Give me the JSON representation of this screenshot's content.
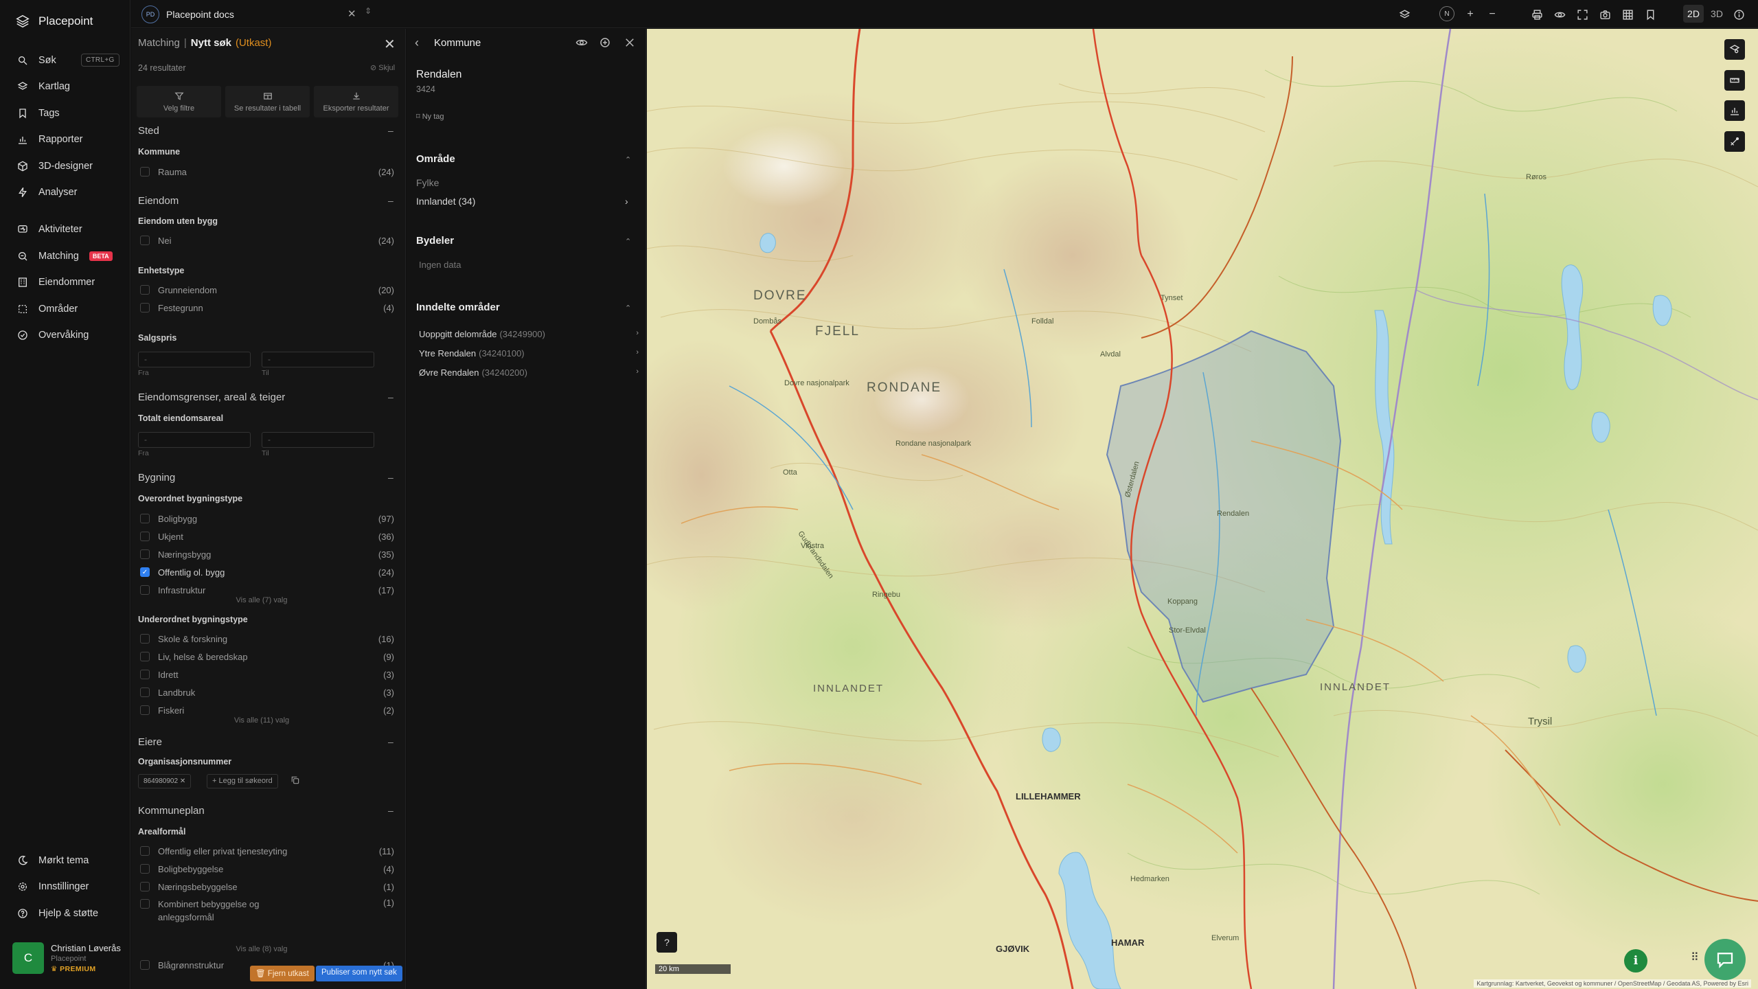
{
  "app": {
    "name": "Placepoint"
  },
  "nav": {
    "shortcut": "CTRL+G",
    "beta": "BETA",
    "items": [
      {
        "label": "Søk",
        "icon": "search-icon"
      },
      {
        "label": "Kartlag",
        "icon": "layers-icon"
      },
      {
        "label": "Tags",
        "icon": "bookmark-icon"
      },
      {
        "label": "Rapporter",
        "icon": "chart-icon"
      },
      {
        "label": "3D-designer",
        "icon": "cube-icon"
      },
      {
        "label": "Analyser",
        "icon": "bolt-icon"
      },
      {
        "label": "Aktiviteter",
        "icon": "activity-icon"
      },
      {
        "label": "Matching",
        "icon": "matching-icon"
      },
      {
        "label": "Eiendommer",
        "icon": "building-icon"
      },
      {
        "label": "Områder",
        "icon": "area-icon"
      },
      {
        "label": "Overvåking",
        "icon": "monitor-icon"
      },
      {
        "label": "Mørkt tema",
        "icon": "moon-icon"
      },
      {
        "label": "Innstillinger",
        "icon": "gear-icon"
      },
      {
        "label": "Hjelp & støtte",
        "icon": "help-icon"
      }
    ],
    "user": {
      "initial": "C",
      "name": "Christian Løverås",
      "org": "Placepoint",
      "plan": "PREMIUM"
    }
  },
  "topbar": {
    "doc_badge": "PD",
    "doc_name": "Placepoint docs",
    "compass": "N",
    "mode_2d": "2D",
    "mode_3d": "3D"
  },
  "search": {
    "crumb": "Matching",
    "title": "Nytt søk",
    "status": "(Utkast)",
    "result_count": "24 resultater",
    "hide": "Skjul",
    "tools": [
      "Velg filtre",
      "Se resultater i tabell",
      "Eksporter resultater"
    ],
    "sections": {
      "sted": "Sted",
      "kommune": "Kommune",
      "kommune_items": [
        {
          "label": "Rauma",
          "count": "(24)"
        }
      ],
      "eiendom": "Eiendom",
      "uten_bygg": "Eiendom uten bygg",
      "uten_bygg_items": [
        {
          "label": "Nei",
          "count": "(24)"
        }
      ],
      "enhetstype": "Enhetstype",
      "enhetstype_items": [
        {
          "label": "Grunneiendom",
          "count": "(20)"
        },
        {
          "label": "Festegrunn",
          "count": "(4)"
        }
      ],
      "salgspris": "Salgspris",
      "grenser": "Eiendomsgrenser, areal & teiger",
      "totalt_areal": "Totalt eiendomsareal",
      "from": "Fra",
      "to": "Til",
      "dash": "-",
      "bygning": "Bygning",
      "overordnet": "Overordnet bygningstype",
      "overordnet_items": [
        {
          "label": "Boligbygg",
          "count": "(97)"
        },
        {
          "label": "Ukjent",
          "count": "(36)"
        },
        {
          "label": "Næringsbygg",
          "count": "(35)"
        },
        {
          "label": "Offentlig ol. bygg",
          "count": "(24)",
          "checked": true
        },
        {
          "label": "Infrastruktur",
          "count": "(17)"
        }
      ],
      "overordnet_all": "Vis alle (7) valg",
      "underordnet": "Underordnet bygningstype",
      "underordnet_items": [
        {
          "label": "Skole & forskning",
          "count": "(16)"
        },
        {
          "label": "Liv, helse & beredskap",
          "count": "(9)"
        },
        {
          "label": "Idrett",
          "count": "(3)"
        },
        {
          "label": "Landbruk",
          "count": "(3)"
        },
        {
          "label": "Fiskeri",
          "count": "(2)"
        }
      ],
      "underordnet_all": "Vis alle (11) valg",
      "eiere": "Eiere",
      "orgnr": "Organisasjonsnummer",
      "org_value": "864980902",
      "add_keyword": "+ Legg til søkeord",
      "kommuneplan": "Kommuneplan",
      "arealformal": "Arealformål",
      "arealformal_items": [
        {
          "label": "Offentlig eller privat tjenesteyting",
          "count": "(11)"
        },
        {
          "label": "Boligbebyggelse",
          "count": "(4)"
        },
        {
          "label": "Næringsbebyggelse",
          "count": "(1)"
        },
        {
          "label": "Kombinert bebyggelse og anleggsformål",
          "count": "(1)"
        },
        {
          "label": "Blågrønnstruktur",
          "count": "(1)"
        }
      ],
      "arealformal_all": "Vis alle (8) valg"
    },
    "btn_remove": "Fjern utkast",
    "btn_publish": "Publiser som nytt søk"
  },
  "detail": {
    "title": "Kommune",
    "name": "Rendalen",
    "code": "3424",
    "new_tag": "Ny tag",
    "omrade": "Område",
    "fylke_lbl": "Fylke",
    "fylke_val": "Innlandet (34)",
    "bydeler": "Bydeler",
    "no_data": "Ingen data",
    "inndelte": "Inndelte områder",
    "areas": [
      {
        "label": "Uoppgitt delområde",
        "code": "(34249900)"
      },
      {
        "label": "Ytre Rendalen",
        "code": "(34240100)"
      },
      {
        "label": "Øvre Rendalen",
        "code": "(34240200)"
      }
    ]
  },
  "map": {
    "labels": {
      "dovre": "DOVRE",
      "fjell": "FJELL",
      "rondane": "RONDANE",
      "innlandet_w": "INNLANDET",
      "innlandet_e": "INNLANDET",
      "lillehammer": "LILLEHAMMER",
      "hamar": "HAMAR",
      "gjovik": "GJØVIK",
      "roros": "Røros",
      "trysil": "Trysil",
      "rendalen": "Rendalen",
      "dovre_np": "Dovre nasjonalpark",
      "rondane_np": "Rondane nasjonalpark",
      "oppdal": "Folldal",
      "ostre": "Østerdalen",
      "gudbrandsdalen": "Gudbrandsdalen",
      "otta": "Otta",
      "ringebu": "Ringebu",
      "hedmarken": "Hedmarken",
      "elverum": "Elverum",
      "koppang": "Koppang",
      "stor_elvdal": "Stor-Elvdal",
      "tynset": "Tynset",
      "alvdal": "Alvdal",
      "vinstra": "Vinstra",
      "dombas": "Dombås"
    },
    "scale": "20 km",
    "attribution": "Kartgrunnlag: Kartverket, Geovekst og kommuner / OpenStreetMap / Geodata AS, Powered by Esri"
  }
}
